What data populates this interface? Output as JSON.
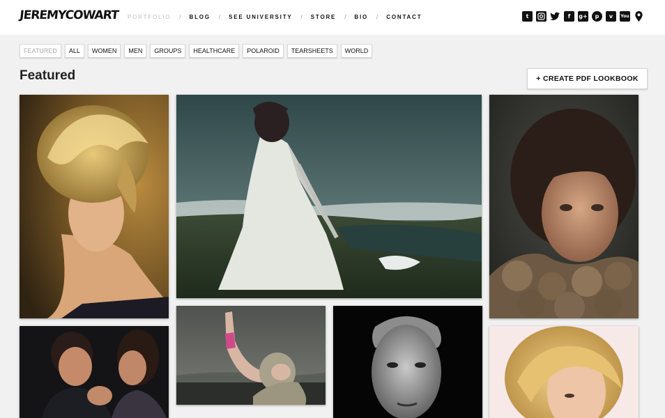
{
  "header": {
    "logo_text": "JEREMYCOWART",
    "nav": [
      "PORTFOLIO",
      "BLOG",
      "SEE UNIVERSITY",
      "STORE",
      "BIO",
      "CONTACT"
    ],
    "nav_separator": "/",
    "active_nav": "PORTFOLIO",
    "social_icons": [
      "tumblr-icon",
      "instagram-icon",
      "twitter-icon",
      "flickr-icon",
      "google-plus-icon",
      "pinterest-icon",
      "vimeo-icon",
      "youtube-icon",
      "location-pin-icon"
    ]
  },
  "filters": {
    "items": [
      "FEATURED",
      "ALL",
      "WOMEN",
      "MEN",
      "GROUPS",
      "HEALTHCARE",
      "POLAROID",
      "TEARSHEETS",
      "WORLD"
    ],
    "active": "FEATURED"
  },
  "page": {
    "title": "Featured",
    "lookbook_button": "+ CREATE PDF LOOKBOOK"
  },
  "gallery": {
    "photos": [
      "woman-blonde-updo-profile",
      "woman-white-coat-wind-landscape",
      "girl-ruffled-collar-portrait",
      "couple-laughing",
      "girl-hooded-reaching-up",
      "man-black-and-white-portrait",
      "blonde-woman-portrait"
    ]
  },
  "colors": {
    "background": "#f1f1f1",
    "header_bg": "#ffffff",
    "nav_active": "#bdbdbd",
    "text": "#111111"
  }
}
